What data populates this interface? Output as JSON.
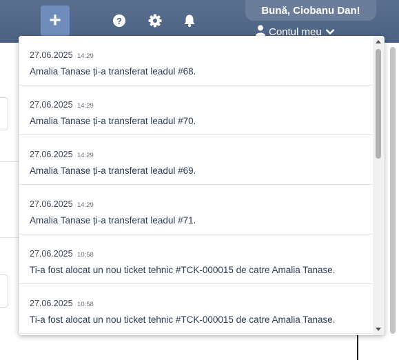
{
  "header": {
    "greeting": "Bună, Ciobanu Dan!",
    "account_label": "Contul meu",
    "icons": [
      "plus-icon",
      "help-icon",
      "gear-icon",
      "bell-icon",
      "user-icon",
      "chevron-down-icon"
    ],
    "colors": {
      "topbar": "#506584",
      "accent_button": "#6f8cbb"
    }
  },
  "notifications": [
    {
      "date": "27.06.2025",
      "time": "14:29",
      "message": "Amalia Tanase ți-a transferat leadul #68."
    },
    {
      "date": "27.06.2025",
      "time": "14:29",
      "message": "Amalia Tanase ți-a transferat leadul #70."
    },
    {
      "date": "27.06.2025",
      "time": "14:29",
      "message": "Amalia Tanase ți-a transferat leadul #69."
    },
    {
      "date": "27.06.2025",
      "time": "14:29",
      "message": "Amalia Tanase ți-a transferat leadul #71."
    },
    {
      "date": "27.06.2025",
      "time": "10:58",
      "message": "Ti-a fost alocat un nou ticket tehnic #TCK-000015 de catre Amalia Tanase."
    },
    {
      "date": "27.06.2025",
      "time": "10:58",
      "message": "Ti-a fost alocat un nou ticket tehnic #TCK-000015 de catre Amalia Tanase."
    }
  ]
}
